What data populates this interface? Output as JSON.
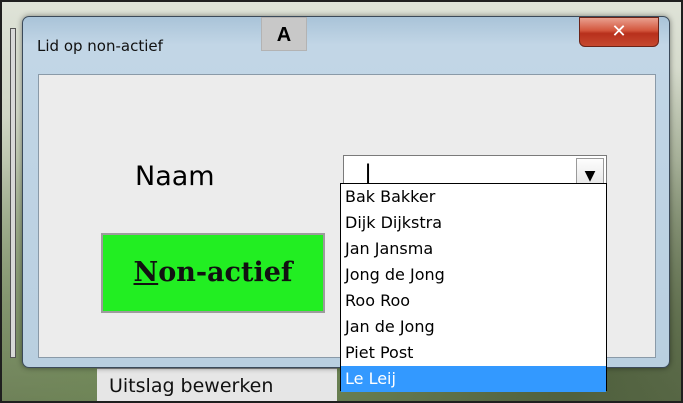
{
  "window": {
    "title": "Lid op non-actief",
    "badge": "A",
    "close_glyph": "✕",
    "icons": {
      "close": "close-icon",
      "dropdown": "chevron-down-icon"
    }
  },
  "form": {
    "naam_label": "Naam",
    "combo_value": "|",
    "button_prefix": "N",
    "button_rest": "on-actief",
    "button_color": "#22ee22"
  },
  "dropdown": {
    "items": [
      "Bak Bakker",
      "Dijk Dijkstra",
      "Jan Jansma",
      "Jong de Jong",
      "Roo Roo",
      "Jan de Jong",
      "Piet Post",
      "Le Leij"
    ],
    "selected_index": 7,
    "highlight_color": "#3399ff"
  },
  "background": {
    "button_label": "Uitslag bewerken"
  }
}
